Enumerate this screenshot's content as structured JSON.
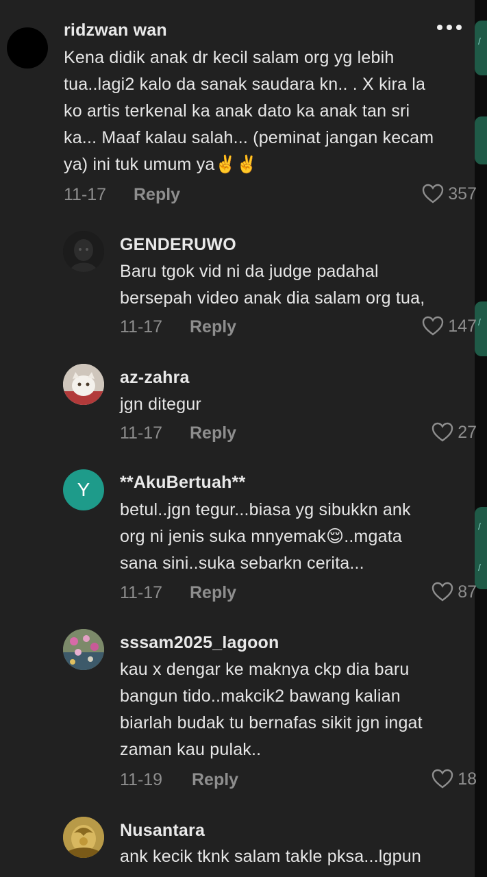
{
  "comments": [
    {
      "username": "ridzwan wan",
      "lines": [
        "Kena didik anak dr kecil salam org yg lebih",
        "tua..lagi2 kalo da sanak saudara kn.. . X kira la",
        "ko artis terkenal ka anak dato ka anak tan sri",
        "ka... Maaf kalau salah... (peminat jangan kecam",
        "ya) ini tuk umum ya✌️✌️"
      ],
      "date": "11-17",
      "reply": "Reply",
      "likes": "357"
    },
    {
      "username": "GENDERUWO",
      "lines": [
        "Baru tgok vid ni da judge padahal",
        "bersepah video anak dia salam org tua,"
      ],
      "date": "11-17",
      "reply": "Reply",
      "likes": "147"
    },
    {
      "username": "az-zahra",
      "lines": [
        "jgn ditegur"
      ],
      "date": "11-17",
      "reply": "Reply",
      "likes": "27"
    },
    {
      "username": "**AkuBertuah**",
      "avatar_letter": "Y",
      "lines": [
        "betul..jgn tegur...biasa yg sibukkn ank",
        "org ni jenis suka mnyemak😌..mgata",
        "sana sini..suka sebarkn cerita..."
      ],
      "date": "11-17",
      "reply": "Reply",
      "likes": "87"
    },
    {
      "username": "sssam2025_lagoon",
      "lines": [
        "kau x dengar ke maknya ckp dia baru",
        "bangun tido..makcik2 bawang kalian",
        "biarlah budak tu bernafas sikit jgn ingat",
        "zaman kau pulak.."
      ],
      "date": "11-19",
      "reply": "Reply",
      "likes": "18"
    },
    {
      "username": "Nusantara",
      "lines": [
        "ank kecik tknk salam takle pksa...lgpun"
      ]
    }
  ],
  "icons": {
    "more": "more-options-icon",
    "like": "heart-outline-icon"
  },
  "colors": {
    "background": "#212121",
    "muted": "#8e8e8e",
    "avatar_y": "#1e9b8a"
  }
}
